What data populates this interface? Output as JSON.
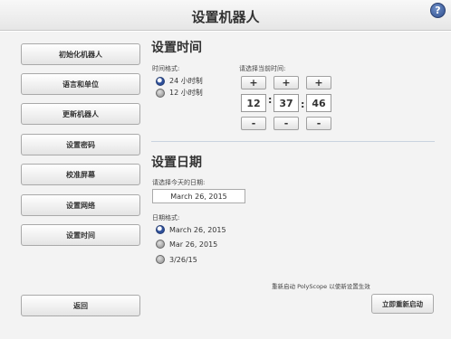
{
  "header": {
    "title": "设置机器人",
    "help_label": "?"
  },
  "sidebar": {
    "items": [
      {
        "label": "初始化机器人"
      },
      {
        "label": "语言和单位"
      },
      {
        "label": "更新机器人"
      },
      {
        "label": "设置密码"
      },
      {
        "label": "校准屏幕"
      },
      {
        "label": "设置网络"
      },
      {
        "label": "设置时间"
      }
    ],
    "back_label": "返回"
  },
  "time_section": {
    "title": "设置时间",
    "format_label": "时间格式:",
    "format_options": [
      {
        "label": "24 小时制",
        "selected": true
      },
      {
        "label": "12 小时制",
        "selected": false
      }
    ],
    "pick_label": "请选择当前时间:",
    "plus": "+",
    "minus": "-",
    "separator": ":",
    "hour": "12",
    "minute": "37",
    "second": "46"
  },
  "date_section": {
    "title": "设置日期",
    "pick_label": "请选择今天的日期:",
    "date_value": "March 26, 2015",
    "format_label": "日期格式:",
    "format_options": [
      {
        "label": "March 26, 2015",
        "selected": true
      },
      {
        "label": "Mar 26, 2015",
        "selected": false
      },
      {
        "label": "3/26/15",
        "selected": false
      }
    ]
  },
  "footer": {
    "restart_note": "重新启动 PolyScope 以使新设置生效",
    "restart_label": "立即重新启动"
  }
}
